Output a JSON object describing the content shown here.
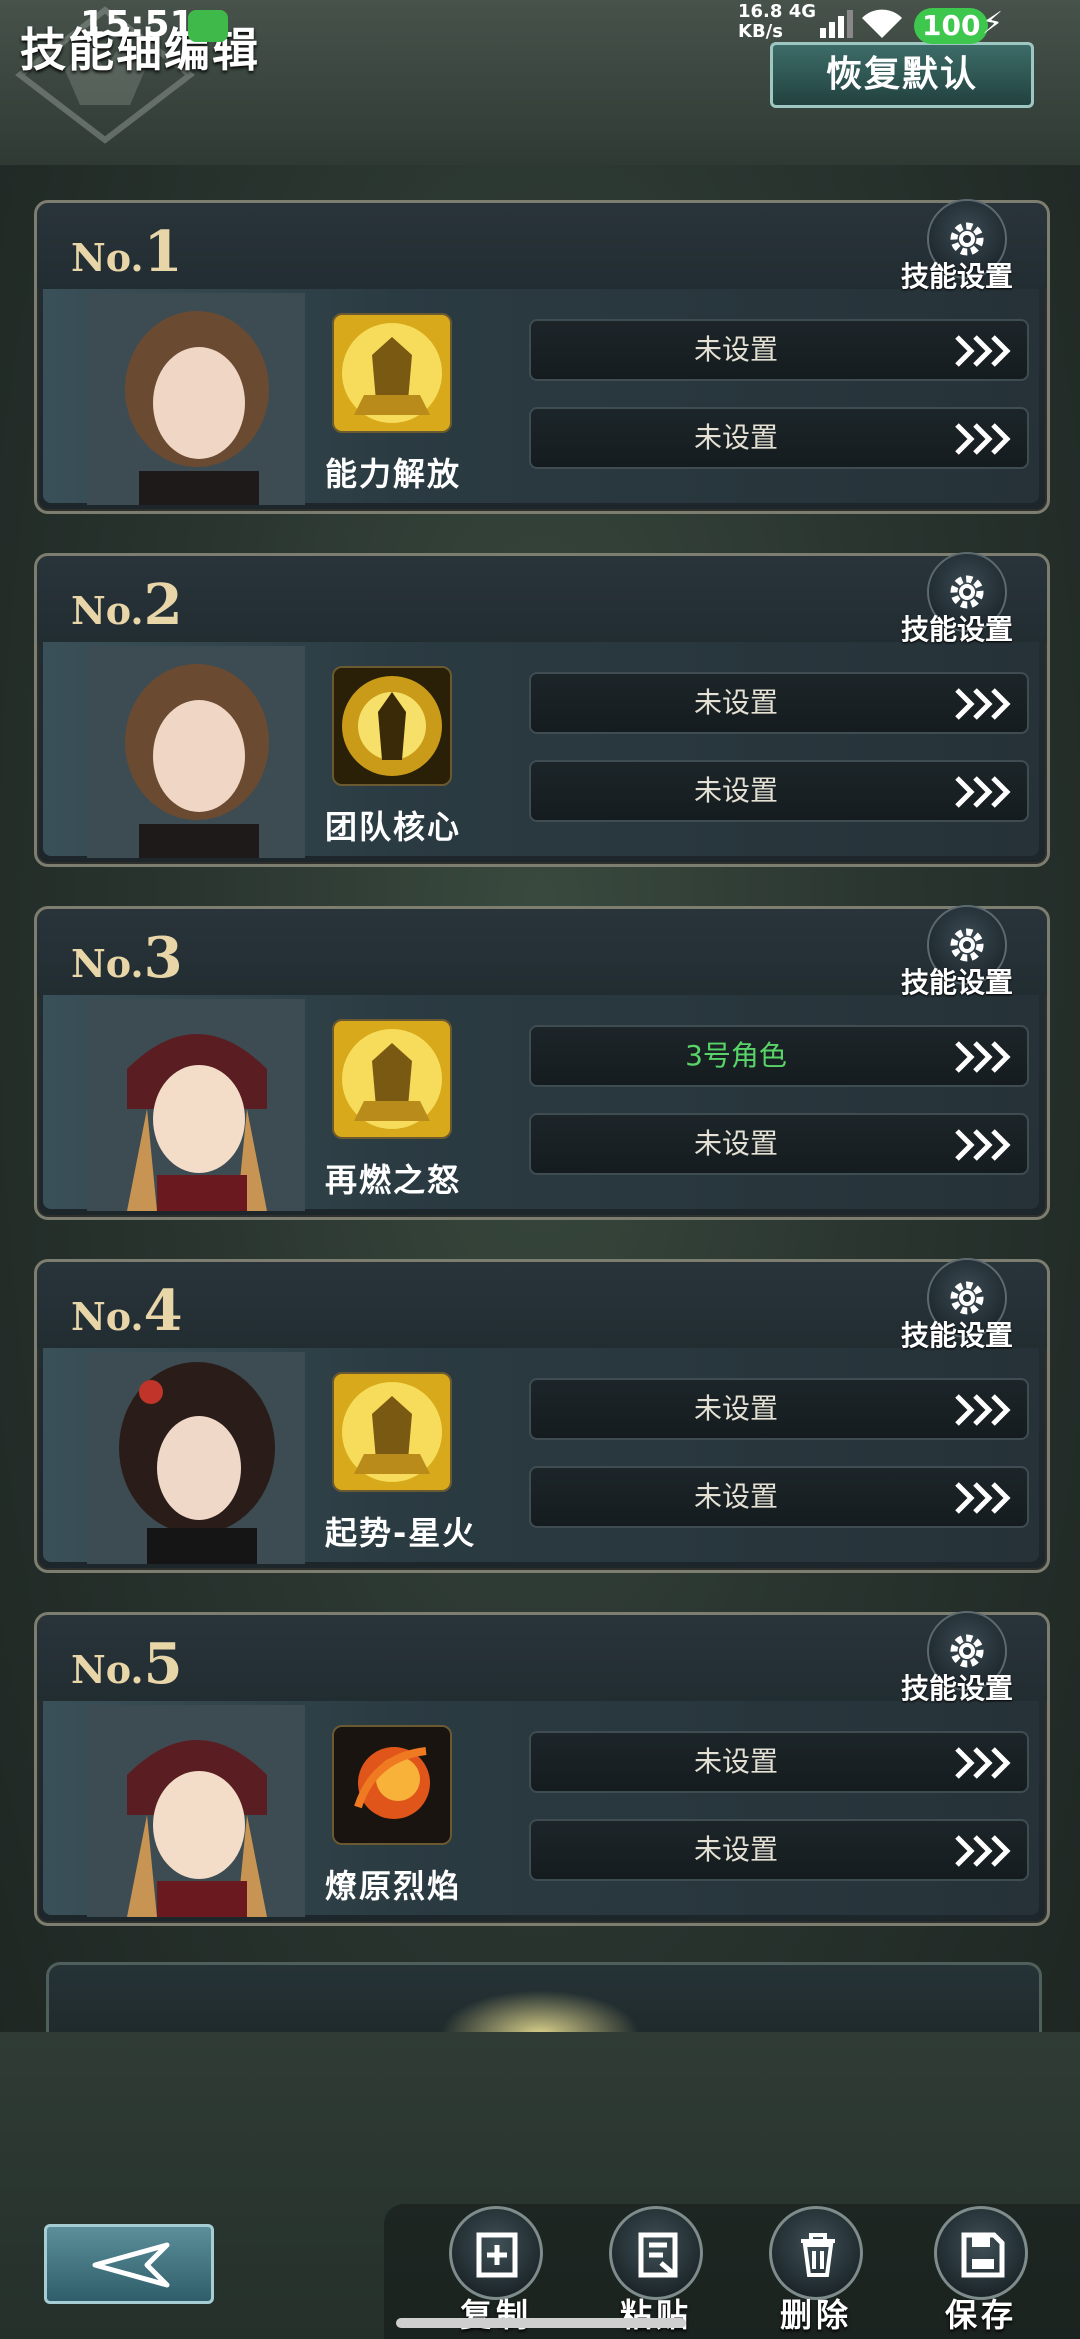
{
  "status_bar": {
    "time": "15:51",
    "net_speed": "16.8",
    "net_unit": "KB/s",
    "net_type": "4G",
    "battery": "100"
  },
  "header": {
    "title": "技能轴编辑",
    "reset_label": "恢复默认"
  },
  "cards": [
    {
      "no_prefix": "No.",
      "no": "1",
      "settings_label": "技能设置",
      "skill_name": "能力解放",
      "skill_icon": "golden-warrior-icon",
      "slots": [
        "未设置",
        "未设置"
      ]
    },
    {
      "no_prefix": "No.",
      "no": "2",
      "settings_label": "技能设置",
      "skill_name": "团队核心",
      "skill_icon": "golden-aura-icon",
      "slots": [
        "未设置",
        "未设置"
      ]
    },
    {
      "no_prefix": "No.",
      "no": "3",
      "settings_label": "技能设置",
      "skill_name": "再燃之怒",
      "skill_icon": "golden-warrior-icon",
      "slots": [
        "3号角色",
        "未设置"
      ]
    },
    {
      "no_prefix": "No.",
      "no": "4",
      "settings_label": "技能设置",
      "skill_name": "起势-星火",
      "skill_icon": "golden-warrior-icon",
      "slots": [
        "未设置",
        "未设置"
      ]
    },
    {
      "no_prefix": "No.",
      "no": "5",
      "settings_label": "技能设置",
      "skill_name": "燎原烈焰",
      "skill_icon": "fireball-icon",
      "slots": [
        "未设置",
        "未设置"
      ]
    }
  ],
  "toolbar": {
    "copy_label": "复制",
    "paste_label": "粘贴",
    "delete_label": "删除",
    "save_label": "保存"
  },
  "colors": {
    "assigned_slot_text": "#58d468",
    "gold_label": "#e8d6a8",
    "battery_green": "#3ec74d"
  }
}
